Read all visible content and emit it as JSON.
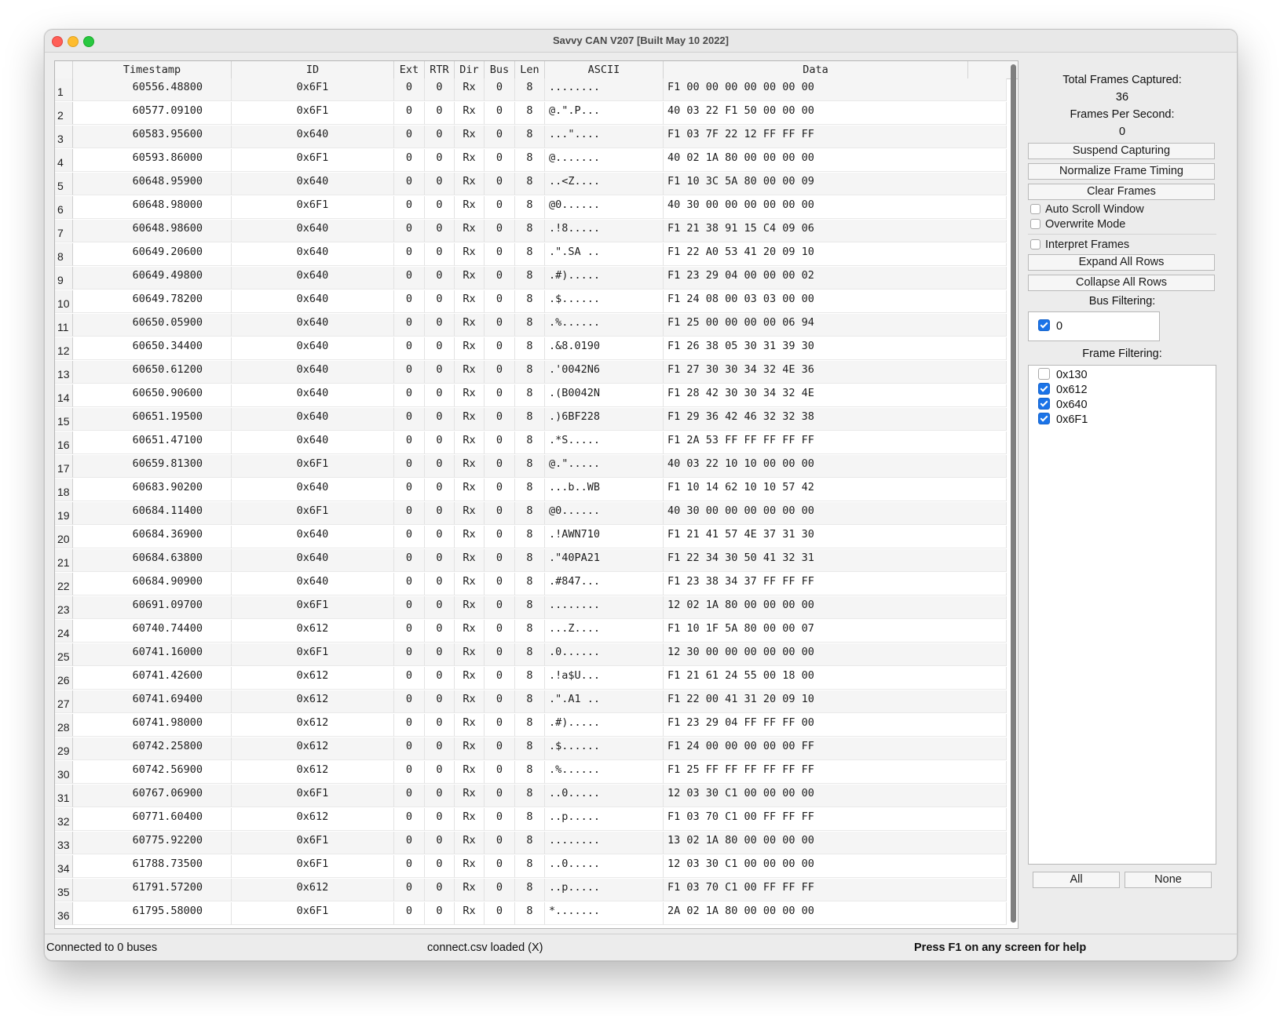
{
  "window": {
    "title": "Savvy CAN V207 [Built May 10 2022]"
  },
  "table": {
    "headers": [
      "Timestamp",
      "ID",
      "Ext",
      "RTR",
      "Dir",
      "Bus",
      "Len",
      "ASCII",
      "Data"
    ],
    "rows": [
      [
        "1",
        "60556.48800",
        "0x6F1",
        "0",
        "0",
        "Rx",
        "0",
        "8",
        "........",
        "F1 00 00 00 00 00 00 00"
      ],
      [
        "2",
        "60577.09100",
        "0x6F1",
        "0",
        "0",
        "Rx",
        "0",
        "8",
        "@.\".P...",
        "40 03 22 F1 50 00 00 00"
      ],
      [
        "3",
        "60583.95600",
        "0x640",
        "0",
        "0",
        "Rx",
        "0",
        "8",
        "...\"....",
        "F1 03 7F 22 12 FF FF FF"
      ],
      [
        "4",
        "60593.86000",
        "0x6F1",
        "0",
        "0",
        "Rx",
        "0",
        "8",
        "@.......",
        "40 02 1A 80 00 00 00 00"
      ],
      [
        "5",
        "60648.95900",
        "0x640",
        "0",
        "0",
        "Rx",
        "0",
        "8",
        "..<Z....",
        "F1 10 3C 5A 80 00 00 09"
      ],
      [
        "6",
        "60648.98000",
        "0x6F1",
        "0",
        "0",
        "Rx",
        "0",
        "8",
        "@0......",
        "40 30 00 00 00 00 00 00"
      ],
      [
        "7",
        "60648.98600",
        "0x640",
        "0",
        "0",
        "Rx",
        "0",
        "8",
        ".!8.....",
        "F1 21 38 91 15 C4 09 06"
      ],
      [
        "8",
        "60649.20600",
        "0x640",
        "0",
        "0",
        "Rx",
        "0",
        "8",
        ".\".SA ..",
        "F1 22 A0 53 41 20 09 10"
      ],
      [
        "9",
        "60649.49800",
        "0x640",
        "0",
        "0",
        "Rx",
        "0",
        "8",
        ".#).....",
        "F1 23 29 04 00 00 00 02"
      ],
      [
        "10",
        "60649.78200",
        "0x640",
        "0",
        "0",
        "Rx",
        "0",
        "8",
        ".$......",
        "F1 24 08 00 03 03 00 00"
      ],
      [
        "11",
        "60650.05900",
        "0x640",
        "0",
        "0",
        "Rx",
        "0",
        "8",
        ".%......",
        "F1 25 00 00 00 00 06 94"
      ],
      [
        "12",
        "60650.34400",
        "0x640",
        "0",
        "0",
        "Rx",
        "0",
        "8",
        ".&8.0190",
        "F1 26 38 05 30 31 39 30"
      ],
      [
        "13",
        "60650.61200",
        "0x640",
        "0",
        "0",
        "Rx",
        "0",
        "8",
        ".'0042N6",
        "F1 27 30 30 34 32 4E 36"
      ],
      [
        "14",
        "60650.90600",
        "0x640",
        "0",
        "0",
        "Rx",
        "0",
        "8",
        ".(B0042N",
        "F1 28 42 30 30 34 32 4E"
      ],
      [
        "15",
        "60651.19500",
        "0x640",
        "0",
        "0",
        "Rx",
        "0",
        "8",
        ".)6BF228",
        "F1 29 36 42 46 32 32 38"
      ],
      [
        "16",
        "60651.47100",
        "0x640",
        "0",
        "0",
        "Rx",
        "0",
        "8",
        ".*S.....",
        "F1 2A 53 FF FF FF FF FF"
      ],
      [
        "17",
        "60659.81300",
        "0x6F1",
        "0",
        "0",
        "Rx",
        "0",
        "8",
        "@.\".....",
        "40 03 22 10 10 00 00 00"
      ],
      [
        "18",
        "60683.90200",
        "0x640",
        "0",
        "0",
        "Rx",
        "0",
        "8",
        "...b..WB",
        "F1 10 14 62 10 10 57 42"
      ],
      [
        "19",
        "60684.11400",
        "0x6F1",
        "0",
        "0",
        "Rx",
        "0",
        "8",
        "@0......",
        "40 30 00 00 00 00 00 00"
      ],
      [
        "20",
        "60684.36900",
        "0x640",
        "0",
        "0",
        "Rx",
        "0",
        "8",
        ".!AWN710",
        "F1 21 41 57 4E 37 31 30"
      ],
      [
        "21",
        "60684.63800",
        "0x640",
        "0",
        "0",
        "Rx",
        "0",
        "8",
        ".\"40PA21",
        "F1 22 34 30 50 41 32 31"
      ],
      [
        "22",
        "60684.90900",
        "0x640",
        "0",
        "0",
        "Rx",
        "0",
        "8",
        ".#847...",
        "F1 23 38 34 37 FF FF FF"
      ],
      [
        "23",
        "60691.09700",
        "0x6F1",
        "0",
        "0",
        "Rx",
        "0",
        "8",
        "........",
        "12 02 1A 80 00 00 00 00"
      ],
      [
        "24",
        "60740.74400",
        "0x612",
        "0",
        "0",
        "Rx",
        "0",
        "8",
        "...Z....",
        "F1 10 1F 5A 80 00 00 07"
      ],
      [
        "25",
        "60741.16000",
        "0x6F1",
        "0",
        "0",
        "Rx",
        "0",
        "8",
        ".0......",
        "12 30 00 00 00 00 00 00"
      ],
      [
        "26",
        "60741.42600",
        "0x612",
        "0",
        "0",
        "Rx",
        "0",
        "8",
        ".!a$U...",
        "F1 21 61 24 55 00 18 00"
      ],
      [
        "27",
        "60741.69400",
        "0x612",
        "0",
        "0",
        "Rx",
        "0",
        "8",
        ".\".A1 ..",
        "F1 22 00 41 31 20 09 10"
      ],
      [
        "28",
        "60741.98000",
        "0x612",
        "0",
        "0",
        "Rx",
        "0",
        "8",
        ".#).....",
        "F1 23 29 04 FF FF FF 00"
      ],
      [
        "29",
        "60742.25800",
        "0x612",
        "0",
        "0",
        "Rx",
        "0",
        "8",
        ".$......",
        "F1 24 00 00 00 00 00 FF"
      ],
      [
        "30",
        "60742.56900",
        "0x612",
        "0",
        "0",
        "Rx",
        "0",
        "8",
        ".%......",
        "F1 25 FF FF FF FF FF FF"
      ],
      [
        "31",
        "60767.06900",
        "0x6F1",
        "0",
        "0",
        "Rx",
        "0",
        "8",
        "..0.....",
        "12 03 30 C1 00 00 00 00"
      ],
      [
        "32",
        "60771.60400",
        "0x612",
        "0",
        "0",
        "Rx",
        "0",
        "8",
        "..p.....",
        "F1 03 70 C1 00 FF FF FF"
      ],
      [
        "33",
        "60775.92200",
        "0x6F1",
        "0",
        "0",
        "Rx",
        "0",
        "8",
        "........",
        "13 02 1A 80 00 00 00 00"
      ],
      [
        "34",
        "61788.73500",
        "0x6F1",
        "0",
        "0",
        "Rx",
        "0",
        "8",
        "..0.....",
        "12 03 30 C1 00 00 00 00"
      ],
      [
        "35",
        "61791.57200",
        "0x612",
        "0",
        "0",
        "Rx",
        "0",
        "8",
        "..p.....",
        "F1 03 70 C1 00 FF FF FF"
      ],
      [
        "36",
        "61795.58000",
        "0x6F1",
        "0",
        "0",
        "Rx",
        "0",
        "8",
        "*.......",
        "2A 02 1A 80 00 00 00 00"
      ]
    ]
  },
  "sidebar": {
    "total_frames_label": "Total Frames Captured:",
    "total_frames_value": "36",
    "fps_label": "Frames Per Second:",
    "fps_value": "0",
    "suspend_button": "Suspend Capturing",
    "normalize_button": "Normalize Frame Timing",
    "clear_button": "Clear Frames",
    "auto_scroll_label": "Auto Scroll Window",
    "auto_scroll_checked": false,
    "overwrite_label": "Overwrite Mode",
    "overwrite_checked": false,
    "interpret_label": "Interpret Frames",
    "interpret_checked": false,
    "expand_button": "Expand All Rows",
    "collapse_button": "Collapse All Rows",
    "bus_filter_label": "Bus Filtering:",
    "bus_filters": [
      {
        "label": "0",
        "checked": true
      }
    ],
    "frame_filter_label": "Frame Filtering:",
    "frame_filters": [
      {
        "label": "0x130",
        "checked": false
      },
      {
        "label": "0x612",
        "checked": true
      },
      {
        "label": "0x640",
        "checked": true
      },
      {
        "label": "0x6F1",
        "checked": true
      }
    ],
    "all_button": "All",
    "none_button": "None"
  },
  "status": {
    "connection": "Connected to 0 buses",
    "file": "connect.csv loaded (X)",
    "help": "Press F1 on any screen for help"
  },
  "colors": {
    "accent": "#1a73e8",
    "close": "#ff5f57",
    "minimize": "#febc2e",
    "maximize": "#28c840"
  }
}
